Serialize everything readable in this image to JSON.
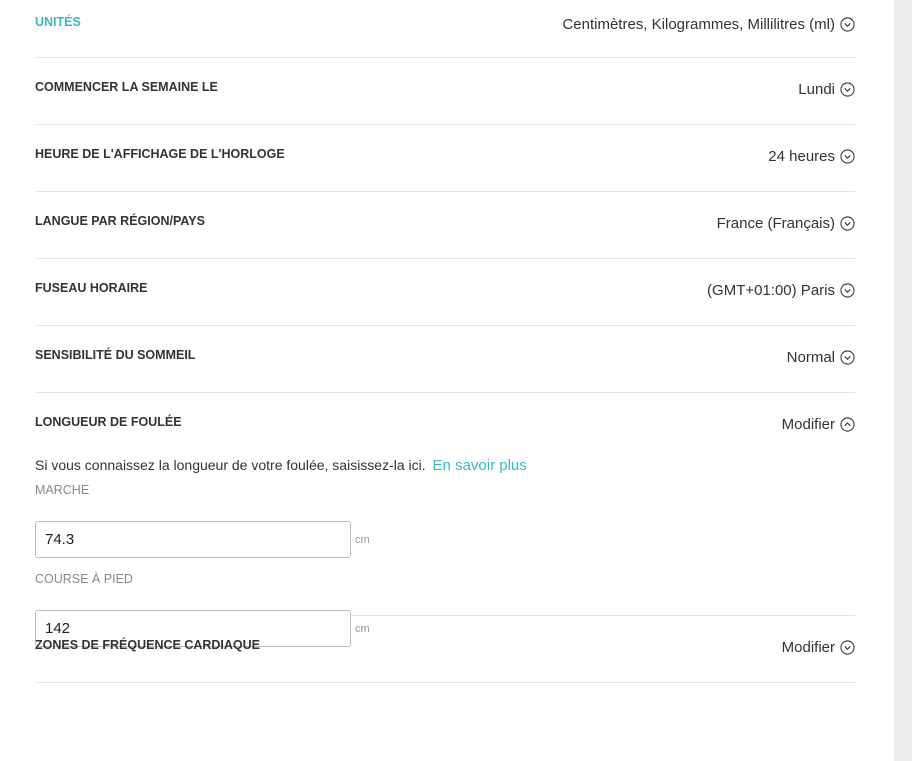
{
  "settings": {
    "units": {
      "label": "UNITÉS",
      "value": "Centimètres, Kilogrammes, Millilitres (ml)"
    },
    "week_start": {
      "label": "COMMENCER LA SEMAINE LE",
      "value": "Lundi"
    },
    "clock": {
      "label": "HEURE DE L'AFFICHAGE DE L'HORLOGE",
      "value": "24 heures"
    },
    "language": {
      "label": "LANGUE PAR RÉGION/PAYS",
      "value": "France (Français)"
    },
    "timezone": {
      "label": "FUSEAU HORAIRE",
      "value": "(GMT+01:00) Paris"
    },
    "sleep": {
      "label": "SENSIBILITÉ DU SOMMEIL",
      "value": "Normal"
    },
    "stride": {
      "label": "LONGUEUR DE FOULÉE",
      "value": "Modifier",
      "help_text": "Si vous connaissez la longueur de votre foulée, saisissez-la ici.",
      "help_link": "En savoir plus",
      "walk_label": "MARCHE",
      "walk_value": "74.3",
      "walk_unit": "cm",
      "run_label": "COURSE À PIED",
      "run_value": "142",
      "run_unit": "cm"
    },
    "heart_rate": {
      "label": "ZONES DE FRÉQUENCE CARDIAQUE",
      "value": "Modifier"
    }
  },
  "colors": {
    "accent": "#3ab7bf",
    "divider": "#e4e4e4",
    "text": "#333333"
  },
  "icons": {
    "collapsed": "chevron-down-circle-icon",
    "expanded": "chevron-up-circle-icon"
  }
}
